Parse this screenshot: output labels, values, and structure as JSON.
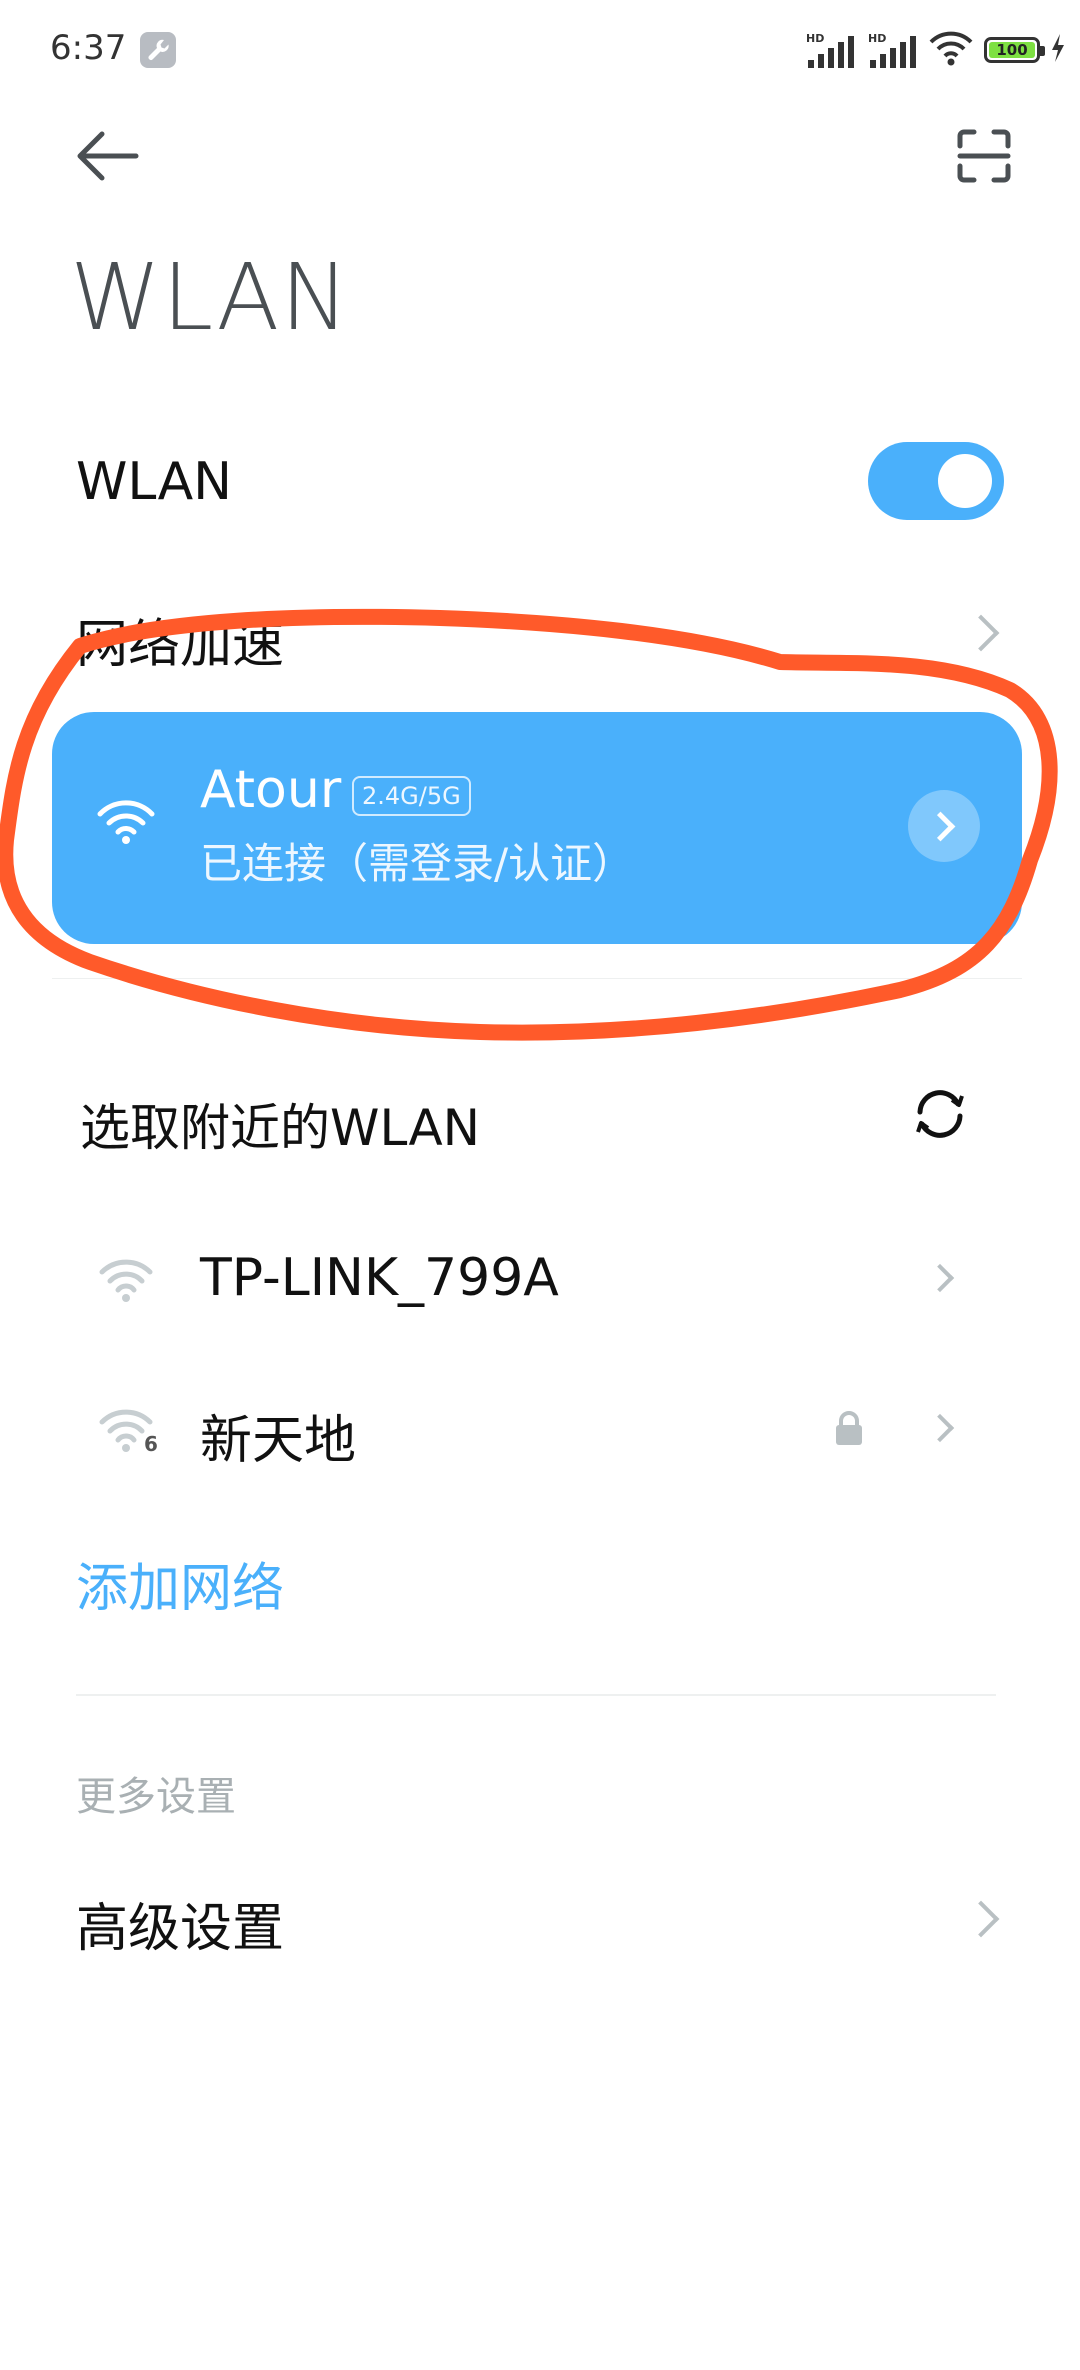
{
  "status_bar": {
    "time": "6:37",
    "battery_level": "100",
    "signal_tag": "HD",
    "icons": [
      "wrench-icon",
      "signal-icon",
      "wifi-icon",
      "battery-icon",
      "charging-icon"
    ]
  },
  "header": {
    "back_icon": "back-arrow-icon",
    "scan_icon": "scan-icon",
    "title": "WLAN"
  },
  "wlan_toggle": {
    "label": "WLAN",
    "state": "on"
  },
  "network_accel": {
    "label": "网络加速"
  },
  "connected": {
    "name": "Atour",
    "band": "2.4G/5G",
    "status": "已连接（需登录/认证）"
  },
  "nearby": {
    "header": "选取附近的WLAN",
    "networks": [
      {
        "name": "TP-LINK_799A",
        "locked": false,
        "wifi_badge": ""
      },
      {
        "name": "新天地",
        "locked": true,
        "wifi_badge": "6"
      }
    ]
  },
  "add_network": {
    "label": "添加网络"
  },
  "more_settings": {
    "header": "更多设置",
    "advanced_label": "高级设置"
  },
  "colors": {
    "accent": "#4ab0fb",
    "annotation": "#ff5a2a",
    "chevron": "#b9c0c3"
  }
}
